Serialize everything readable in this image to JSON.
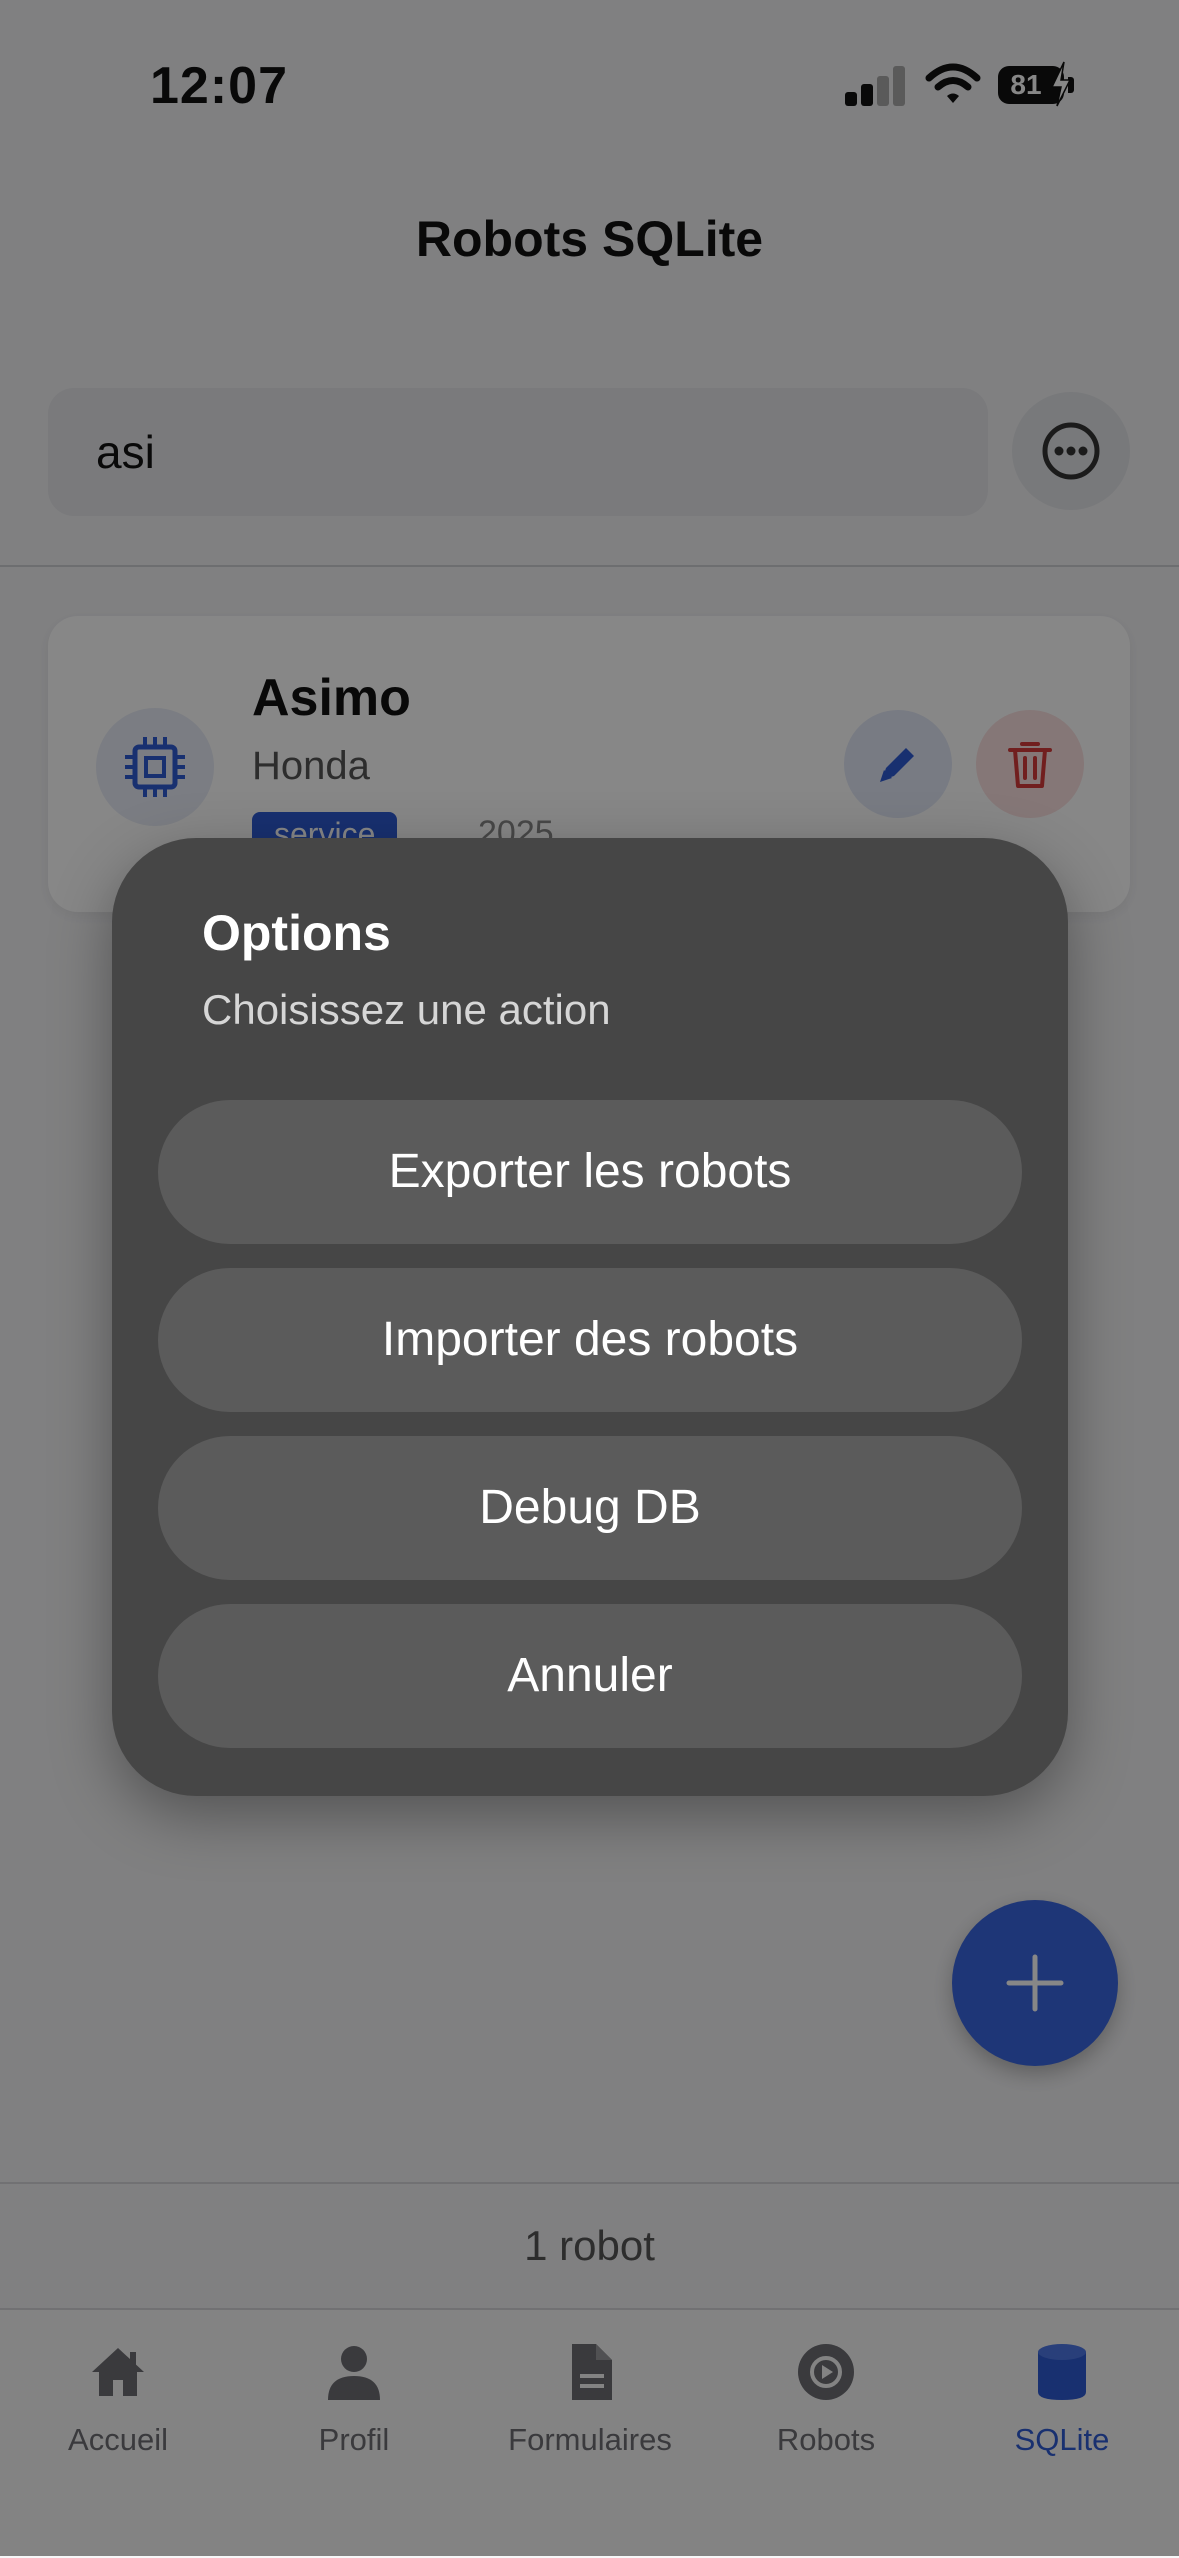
{
  "status_bar": {
    "time": "12:07",
    "battery": "81"
  },
  "header": {
    "title": "Robots SQLite"
  },
  "search": {
    "value": "asi",
    "more_icon": "ellipsis-circle-icon"
  },
  "robots": [
    {
      "name": "Asimo",
      "maker": "Honda",
      "tag": "service",
      "year": "2025",
      "icon": "chip-icon"
    }
  ],
  "count_text": "1 robot",
  "tabs": [
    {
      "label": "Accueil",
      "icon": "home-icon",
      "active": false
    },
    {
      "label": "Profil",
      "icon": "person-icon",
      "active": false
    },
    {
      "label": "Formulaires",
      "icon": "document-icon",
      "active": false
    },
    {
      "label": "Robots",
      "icon": "robot-gear-icon",
      "active": false
    },
    {
      "label": "SQLite",
      "icon": "database-icon",
      "active": true
    }
  ],
  "dialog": {
    "title": "Options",
    "subtitle": "Choisissez une action",
    "buttons": [
      "Exporter les robots",
      "Importer des robots",
      "Debug DB",
      "Annuler"
    ]
  },
  "colors": {
    "accent": "#2f5bd3",
    "fab": "#3a66e0",
    "danger": "#d63b3b",
    "dialog_bg": "#464646"
  }
}
